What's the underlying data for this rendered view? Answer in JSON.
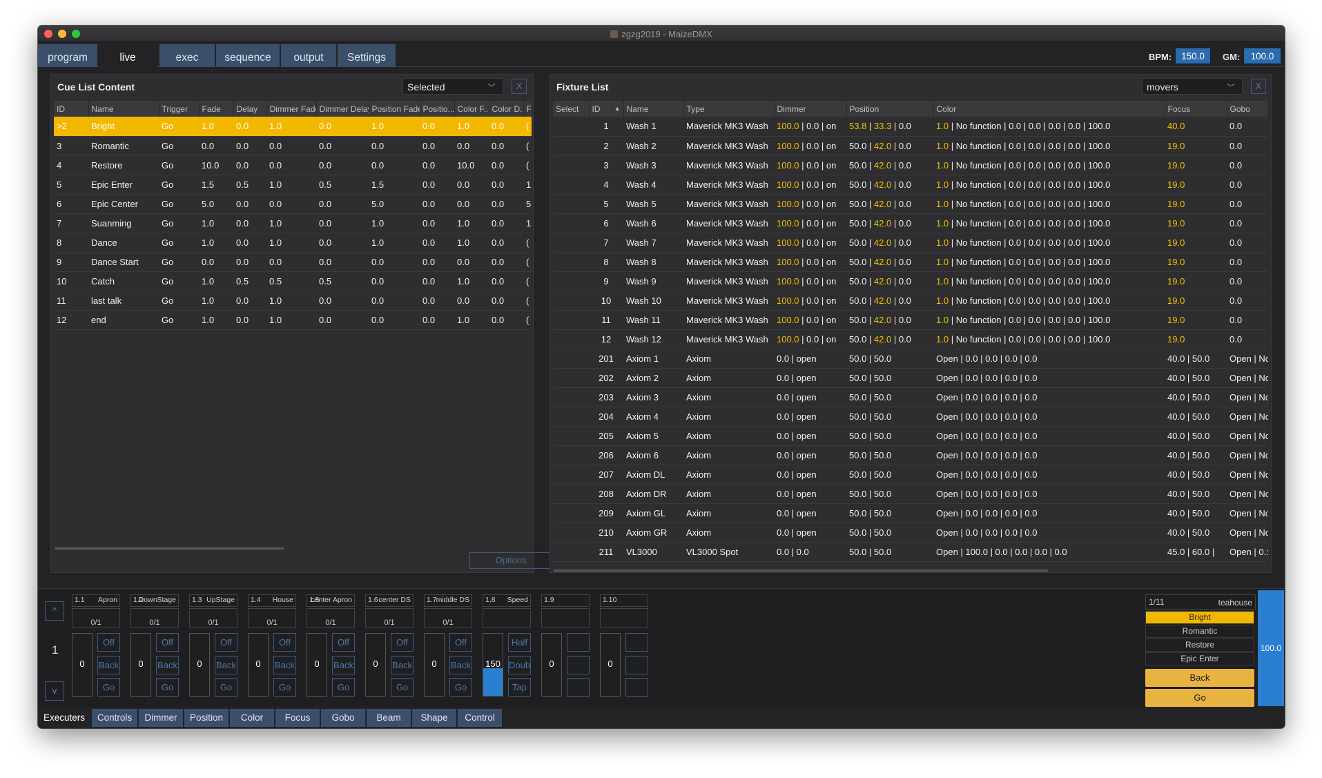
{
  "window": {
    "title": "zgzg2019 - MaizeDMX"
  },
  "tabs": [
    "program",
    "live",
    "exec",
    "sequence",
    "output",
    "Settings"
  ],
  "active_tab": "live",
  "bpm": {
    "label": "BPM:",
    "value": "150.0"
  },
  "gm": {
    "label": "GM:",
    "value": "100.0"
  },
  "cue_panel": {
    "title": "Cue List Content",
    "selector": "Selected",
    "close": "X",
    "columns": [
      "ID",
      "Name",
      "Trigger",
      "Fade",
      "Delay",
      "Dimmer Fade",
      "Dimmer Delay",
      "Position Fade",
      "Positio...",
      "Color F...",
      "Color D...",
      "F"
    ],
    "rows": [
      [
        ">2",
        "Bright",
        "Go",
        "1.0",
        "0.0",
        "1.0",
        "0.0",
        "1.0",
        "0.0",
        "1.0",
        "0.0",
        "("
      ],
      [
        "3",
        "Romantic",
        "Go",
        "0.0",
        "0.0",
        "0.0",
        "0.0",
        "0.0",
        "0.0",
        "0.0",
        "0.0",
        "("
      ],
      [
        "4",
        "Restore",
        "Go",
        "10.0",
        "0.0",
        "0.0",
        "0.0",
        "0.0",
        "0.0",
        "10.0",
        "0.0",
        "("
      ],
      [
        "5",
        "Epic Enter",
        "Go",
        "1.5",
        "0.5",
        "1.0",
        "0.5",
        "1.5",
        "0.0",
        "0.0",
        "0.0",
        "1"
      ],
      [
        "6",
        "Epic Center",
        "Go",
        "5.0",
        "0.0",
        "0.0",
        "0.0",
        "5.0",
        "0.0",
        "0.0",
        "0.0",
        "5"
      ],
      [
        "7",
        "Suanming",
        "Go",
        "1.0",
        "0.0",
        "1.0",
        "0.0",
        "1.0",
        "0.0",
        "1.0",
        "0.0",
        "1"
      ],
      [
        "8",
        "Dance",
        "Go",
        "1.0",
        "0.0",
        "1.0",
        "0.0",
        "1.0",
        "0.0",
        "1.0",
        "0.0",
        "("
      ],
      [
        "9",
        "Dance Start",
        "Go",
        "0.0",
        "0.0",
        "0.0",
        "0.0",
        "0.0",
        "0.0",
        "0.0",
        "0.0",
        "("
      ],
      [
        "10",
        "Catch",
        "Go",
        "1.0",
        "0.5",
        "0.5",
        "0.5",
        "0.0",
        "0.0",
        "1.0",
        "0.0",
        "("
      ],
      [
        "11",
        "last talk",
        "Go",
        "1.0",
        "0.0",
        "1.0",
        "0.0",
        "0.0",
        "0.0",
        "0.0",
        "0.0",
        "("
      ],
      [
        "12",
        "end",
        "Go",
        "1.0",
        "0.0",
        "1.0",
        "0.0",
        "0.0",
        "0.0",
        "1.0",
        "0.0",
        "("
      ]
    ],
    "options_label": "Options"
  },
  "fixture_panel": {
    "title": "Fixture List",
    "selector": "movers",
    "close": "X",
    "columns": [
      "Select",
      "ID",
      "Name",
      "Type",
      "Dimmer",
      "Position",
      "Color",
      "Focus",
      "Gobo"
    ],
    "rows": [
      [
        "",
        "1",
        "Wash 1",
        "Maverick MK3 Wash",
        "100.0 | 0.0 | on",
        "53.8 | 33.3 | 0.0",
        "1.0 | No function | 0.0 | 0.0 | 0.0 | 0.0 | 100.0",
        "40.0",
        "0.0"
      ],
      [
        "",
        "2",
        "Wash 2",
        "Maverick MK3 Wash",
        "100.0 | 0.0 | on",
        "50.0 | 42.0 | 0.0",
        "1.0 | No function | 0.0 | 0.0 | 0.0 | 0.0 | 100.0",
        "19.0",
        "0.0"
      ],
      [
        "",
        "3",
        "Wash 3",
        "Maverick MK3 Wash",
        "100.0 | 0.0 | on",
        "50.0 | 42.0 | 0.0",
        "1.0 | No function | 0.0 | 0.0 | 0.0 | 0.0 | 100.0",
        "19.0",
        "0.0"
      ],
      [
        "",
        "4",
        "Wash 4",
        "Maverick MK3 Wash",
        "100.0 | 0.0 | on",
        "50.0 | 42.0 | 0.0",
        "1.0 | No function | 0.0 | 0.0 | 0.0 | 0.0 | 100.0",
        "19.0",
        "0.0"
      ],
      [
        "",
        "5",
        "Wash 5",
        "Maverick MK3 Wash",
        "100.0 | 0.0 | on",
        "50.0 | 42.0 | 0.0",
        "1.0 | No function | 0.0 | 0.0 | 0.0 | 0.0 | 100.0",
        "19.0",
        "0.0"
      ],
      [
        "",
        "6",
        "Wash 6",
        "Maverick MK3 Wash",
        "100.0 | 0.0 | on",
        "50.0 | 42.0 | 0.0",
        "1.0 | No function | 0.0 | 0.0 | 0.0 | 0.0 | 100.0",
        "19.0",
        "0.0"
      ],
      [
        "",
        "7",
        "Wash 7",
        "Maverick MK3 Wash",
        "100.0 | 0.0 | on",
        "50.0 | 42.0 | 0.0",
        "1.0 | No function | 0.0 | 0.0 | 0.0 | 0.0 | 100.0",
        "19.0",
        "0.0"
      ],
      [
        "",
        "8",
        "Wash 8",
        "Maverick MK3 Wash",
        "100.0 | 0.0 | on",
        "50.0 | 42.0 | 0.0",
        "1.0 | No function | 0.0 | 0.0 | 0.0 | 0.0 | 100.0",
        "19.0",
        "0.0"
      ],
      [
        "",
        "9",
        "Wash 9",
        "Maverick MK3 Wash",
        "100.0 | 0.0 | on",
        "50.0 | 42.0 | 0.0",
        "1.0 | No function | 0.0 | 0.0 | 0.0 | 0.0 | 100.0",
        "19.0",
        "0.0"
      ],
      [
        "",
        "10",
        "Wash 10",
        "Maverick MK3 Wash",
        "100.0 | 0.0 | on",
        "50.0 | 42.0 | 0.0",
        "1.0 | No function | 0.0 | 0.0 | 0.0 | 0.0 | 100.0",
        "19.0",
        "0.0"
      ],
      [
        "",
        "11",
        "Wash 11",
        "Maverick MK3 Wash",
        "100.0 | 0.0 | on",
        "50.0 | 42.0 | 0.0",
        "1.0 | No function | 0.0 | 0.0 | 0.0 | 0.0 | 100.0",
        "19.0",
        "0.0"
      ],
      [
        "",
        "12",
        "Wash 12",
        "Maverick MK3 Wash",
        "100.0 | 0.0 | on",
        "50.0 | 42.0 | 0.0",
        "1.0 | No function | 0.0 | 0.0 | 0.0 | 0.0 | 100.0",
        "19.0",
        "0.0"
      ],
      [
        "",
        "201",
        "Axiom 1",
        "Axiom",
        "0.0 | open",
        "50.0 | 50.0",
        "Open | 0.0 | 0.0 | 0.0 | 0.0",
        "40.0 | 50.0",
        "Open | No"
      ],
      [
        "",
        "202",
        "Axiom 2",
        "Axiom",
        "0.0 | open",
        "50.0 | 50.0",
        "Open | 0.0 | 0.0 | 0.0 | 0.0",
        "40.0 | 50.0",
        "Open | No"
      ],
      [
        "",
        "203",
        "Axiom 3",
        "Axiom",
        "0.0 | open",
        "50.0 | 50.0",
        "Open | 0.0 | 0.0 | 0.0 | 0.0",
        "40.0 | 50.0",
        "Open | No"
      ],
      [
        "",
        "204",
        "Axiom 4",
        "Axiom",
        "0.0 | open",
        "50.0 | 50.0",
        "Open | 0.0 | 0.0 | 0.0 | 0.0",
        "40.0 | 50.0",
        "Open | No"
      ],
      [
        "",
        "205",
        "Axiom 5",
        "Axiom",
        "0.0 | open",
        "50.0 | 50.0",
        "Open | 0.0 | 0.0 | 0.0 | 0.0",
        "40.0 | 50.0",
        "Open | No"
      ],
      [
        "",
        "206",
        "Axiom 6",
        "Axiom",
        "0.0 | open",
        "50.0 | 50.0",
        "Open | 0.0 | 0.0 | 0.0 | 0.0",
        "40.0 | 50.0",
        "Open | No"
      ],
      [
        "",
        "207",
        "Axiom DL",
        "Axiom",
        "0.0 | open",
        "50.0 | 50.0",
        "Open | 0.0 | 0.0 | 0.0 | 0.0",
        "40.0 | 50.0",
        "Open | No"
      ],
      [
        "",
        "208",
        "Axiom DR",
        "Axiom",
        "0.0 | open",
        "50.0 | 50.0",
        "Open | 0.0 | 0.0 | 0.0 | 0.0",
        "40.0 | 50.0",
        "Open | No"
      ],
      [
        "",
        "209",
        "Axiom GL",
        "Axiom",
        "0.0 | open",
        "50.0 | 50.0",
        "Open | 0.0 | 0.0 | 0.0 | 0.0",
        "40.0 | 50.0",
        "Open | No"
      ],
      [
        "",
        "210",
        "Axiom GR",
        "Axiom",
        "0.0 | open",
        "50.0 | 50.0",
        "Open | 0.0 | 0.0 | 0.0 | 0.0",
        "40.0 | 50.0",
        "Open | No"
      ],
      [
        "",
        "211",
        "VL3000",
        "VL3000 Spot",
        "0.0 | 0.0",
        "50.0 | 50.0",
        "Open | 100.0 | 0.0 | 0.0 | 0.0 | 0.0",
        "45.0 | 60.0 |",
        "Open | 0.:"
      ]
    ]
  },
  "executors": {
    "page": "1",
    "up": "^",
    "down": "v",
    "items": [
      {
        "num": "1.1",
        "name": "Apron",
        "count": "0/1",
        "value": "0",
        "btn1": "Off",
        "btn2": "Back",
        "btn3": "Go",
        "level": 0
      },
      {
        "num": "1.2",
        "name": "DownStage",
        "count": "0/1",
        "value": "0",
        "btn1": "Off",
        "btn2": "Back",
        "btn3": "Go",
        "level": 0
      },
      {
        "num": "1.3",
        "name": "UpStage",
        "count": "0/1",
        "value": "0",
        "btn1": "Off",
        "btn2": "Back",
        "btn3": "Go",
        "level": 0
      },
      {
        "num": "1.4",
        "name": "House",
        "count": "0/1",
        "value": "0",
        "btn1": "Off",
        "btn2": "Back",
        "btn3": "Go",
        "level": 0
      },
      {
        "num": "1.5",
        "name": "center Apron",
        "count": "0/1",
        "value": "0",
        "btn1": "Off",
        "btn2": "Back",
        "btn3": "Go",
        "level": 0
      },
      {
        "num": "1.6",
        "name": "center DS",
        "count": "0/1",
        "value": "0",
        "btn1": "Off",
        "btn2": "Back",
        "btn3": "Go",
        "level": 0
      },
      {
        "num": "1.7",
        "name": "middle DS",
        "count": "0/1",
        "value": "0",
        "btn1": "Off",
        "btn2": "Back",
        "btn3": "Go",
        "level": 0
      },
      {
        "num": "1.8",
        "name": "Speed",
        "count": "",
        "value": "150",
        "btn1": "Half",
        "btn2": "Doub",
        "btn3": "Tap",
        "level": 0.45
      },
      {
        "num": "1.9",
        "name": "",
        "count": "",
        "value": "0",
        "btn1": "",
        "btn2": "",
        "btn3": "",
        "level": 0
      },
      {
        "num": "1.10",
        "name": "",
        "count": "",
        "value": "0",
        "btn1": "",
        "btn2": "",
        "btn3": "",
        "level": 0
      }
    ]
  },
  "cue_stack": {
    "position": "1/11",
    "name": "teahouse",
    "cues": [
      "Bright",
      "Romantic",
      "Restore",
      "Epic Enter"
    ],
    "back": "Back",
    "go": "Go",
    "master": "100.0"
  },
  "bottom_tabs": [
    "Executers",
    "Controls",
    "Dimmer",
    "Position",
    "Color",
    "Focus",
    "Gobo",
    "Beam",
    "Shape",
    "Control"
  ],
  "active_bottom_tab": "Executers",
  "colors": {
    "accent": "#2b7fd0",
    "highlight": "#f2b800",
    "tab": "#3b4f6b",
    "background": "#232325",
    "yellow_text": "#f2c200"
  }
}
